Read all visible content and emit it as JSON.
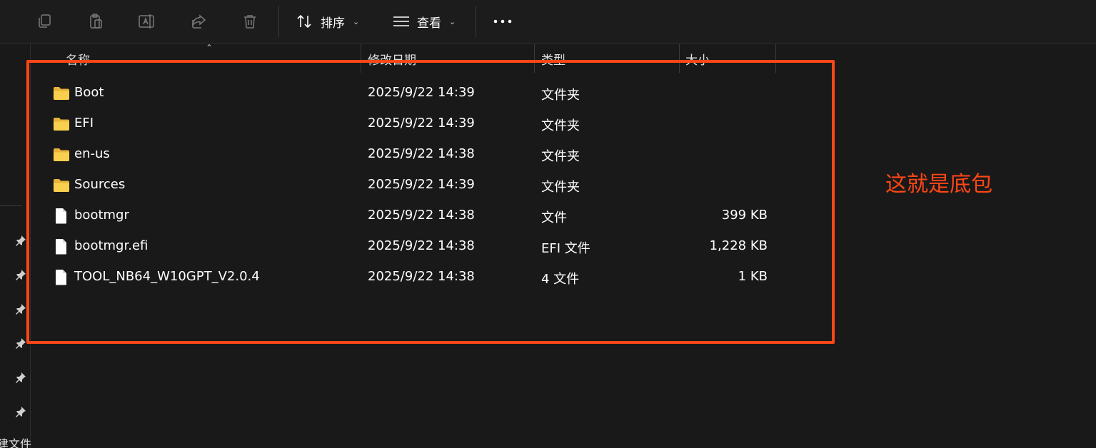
{
  "toolbar": {
    "icons": [
      "copy-icon",
      "paste-icon",
      "rename-icon",
      "share-icon",
      "delete-icon"
    ],
    "sort_label": "排序",
    "view_label": "查看",
    "more_label": "•••"
  },
  "columns": {
    "name": "名称",
    "modified": "修改日期",
    "type": "类型",
    "size": "大小"
  },
  "files": [
    {
      "name": "Boot",
      "modified": "2025/9/22 14:39",
      "type": "文件夹",
      "size": "",
      "icon": "folder-icon"
    },
    {
      "name": "EFI",
      "modified": "2025/9/22 14:39",
      "type": "文件夹",
      "size": "",
      "icon": "folder-icon"
    },
    {
      "name": "en-us",
      "modified": "2025/9/22 14:38",
      "type": "文件夹",
      "size": "",
      "icon": "folder-icon"
    },
    {
      "name": "Sources",
      "modified": "2025/9/22 14:39",
      "type": "文件夹",
      "size": "",
      "icon": "folder-icon"
    },
    {
      "name": "bootmgr",
      "modified": "2025/9/22 14:38",
      "type": "文件",
      "size": "399 KB",
      "icon": "file-icon"
    },
    {
      "name": "bootmgr.efi",
      "modified": "2025/9/22 14:38",
      "type": "EFI 文件",
      "size": "1,228 KB",
      "icon": "file-icon"
    },
    {
      "name": "TOOL_NB64_W10GPT_V2.0.4",
      "modified": "2025/9/22 14:38",
      "type": "4 文件",
      "size": "1 KB",
      "icon": "file-icon"
    }
  ],
  "nav": {
    "bottom_label": "建文件"
  },
  "annotation": {
    "text": "这就是底包",
    "color": "#ff4616"
  },
  "colors": {
    "background": "#191919",
    "folder": "#f5c542",
    "accent": "#ff4616"
  }
}
